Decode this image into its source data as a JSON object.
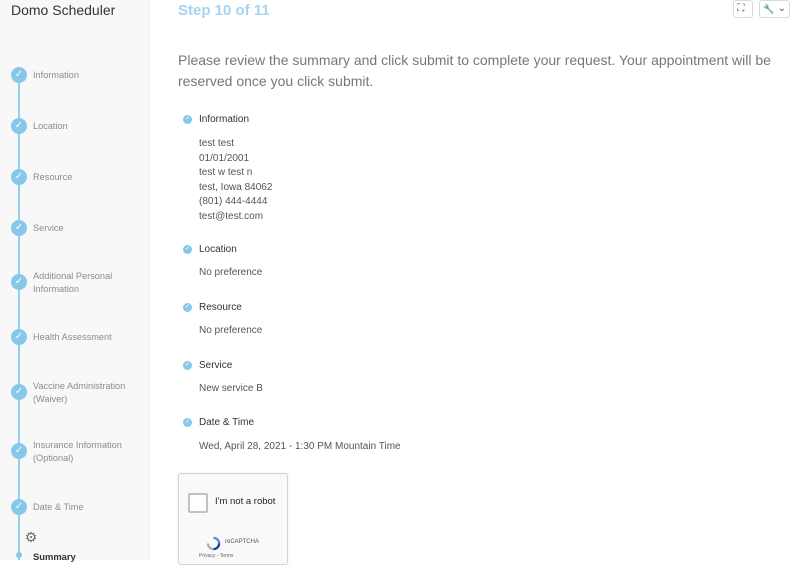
{
  "app": {
    "title": "Domo Scheduler"
  },
  "sidebar": {
    "steps": [
      {
        "label": "Information"
      },
      {
        "label": "Location"
      },
      {
        "label": "Resource"
      },
      {
        "label": "Service"
      },
      {
        "label": "Additional Personal Information"
      },
      {
        "label": "Health Assessment"
      },
      {
        "label": "Vaccine Administration (Waiver)"
      },
      {
        "label": "Insurance Information (Optional)"
      },
      {
        "label": "Date & Time"
      }
    ],
    "current_step": "Summary",
    "check_icon": "✓",
    "settings_icon": "⚙",
    "accent_color": "#86c7ea"
  },
  "header": {
    "step_indicator": "Step 10 of 11",
    "fullscreen_icon": "⛶",
    "wrench_icon": "🔧",
    "chevron_icon": "⌄"
  },
  "main": {
    "intro": "Please review the summary and click submit to complete your request. Your appointment will be reserved once you click submit.",
    "sections": [
      {
        "title": "Information",
        "lines": [
          "test test",
          "01/01/2001",
          "test w test n",
          "test, Iowa 84062",
          "(801) 444-4444",
          "test@test.com"
        ]
      },
      {
        "title": "Location",
        "lines": [
          "No preference"
        ]
      },
      {
        "title": "Resource",
        "lines": [
          "No preference"
        ]
      },
      {
        "title": "Service",
        "lines": [
          "New service B"
        ]
      },
      {
        "title": "Date & Time",
        "lines": [
          "Wed, April 28, 2021 - 1:30 PM Mountain Time"
        ]
      }
    ]
  },
  "captcha": {
    "label": "I'm not a robot",
    "brand": "reCAPTCHA",
    "terms": "Privacy - Terms"
  }
}
